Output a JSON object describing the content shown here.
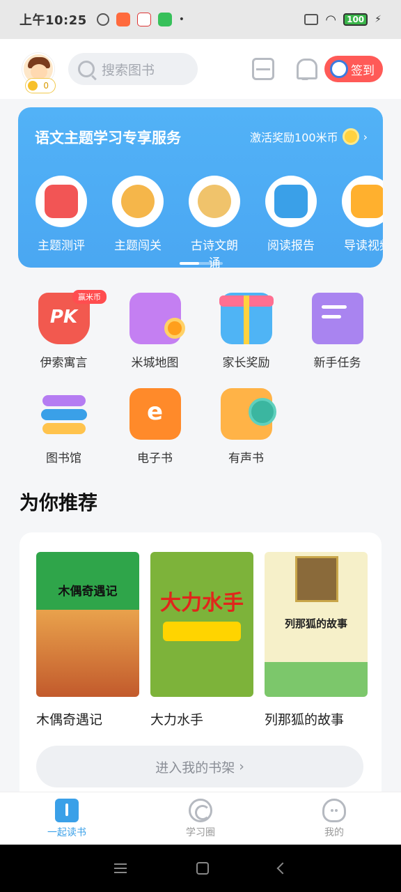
{
  "status_bar": {
    "time": "上午10:25",
    "battery": "100"
  },
  "header": {
    "avatar_coins": "0",
    "search_placeholder": "搜索图书",
    "signin_label": "签到",
    "icons": [
      "scan-icon",
      "bell-icon"
    ]
  },
  "banner": {
    "title": "语文主题学习专享服务",
    "reward_text": "激活奖励100米币",
    "reward_chevron": "›",
    "services": [
      {
        "label": "主题测评",
        "icon": "notebook-icon",
        "color": "#f25555"
      },
      {
        "label": "主题闯关",
        "icon": "kid-adventure-icon",
        "color": "#f5b64a"
      },
      {
        "label": "古诗文朗诵",
        "icon": "ancient-kid-icon",
        "color": "#f0c36b"
      },
      {
        "label": "阅读报告",
        "icon": "report-icon",
        "color": "#3aa0e8"
      },
      {
        "label": "导读视频",
        "icon": "video-icon",
        "color": "#ffb02e"
      }
    ]
  },
  "quick_entries": [
    {
      "label": "伊索寓言",
      "icon": "pk-icon",
      "tag": "赢米币",
      "color": "#f2594f"
    },
    {
      "label": "米城地图",
      "icon": "map-icon",
      "tag": "",
      "color": "#c47ff2"
    },
    {
      "label": "家长奖励",
      "icon": "gift-icon",
      "tag": "",
      "color": "#4fb4f5"
    },
    {
      "label": "新手任务",
      "icon": "scroll-icon",
      "tag": "",
      "color": "#a984f0"
    },
    {
      "label": "图书馆",
      "icon": "library-books-icon",
      "tag": "",
      "color": "#3aa0e8"
    },
    {
      "label": "电子书",
      "icon": "ebook-icon",
      "tag": "",
      "color": "#ff8a2a"
    },
    {
      "label": "有声书",
      "icon": "audiobook-icon",
      "tag": "",
      "color": "#ffb347"
    }
  ],
  "recommend": {
    "title": "为你推荐",
    "books": [
      {
        "title": "木偶奇遇记",
        "cover_text": "木偶奇遇记",
        "cover_color": "#2fa54a"
      },
      {
        "title": "大力水手",
        "cover_text": "大力水手",
        "cover_color": "#7db33a"
      },
      {
        "title": "列那狐的故事",
        "cover_text": "列那狐的故事",
        "cover_color": "#f6f0c9"
      }
    ],
    "shelf_button": "进入我的书架",
    "shelf_chevron": "›"
  },
  "bottom_nav": [
    {
      "label": "一起读书",
      "active": true
    },
    {
      "label": "学习圈",
      "active": false
    },
    {
      "label": "我的",
      "active": false
    }
  ]
}
